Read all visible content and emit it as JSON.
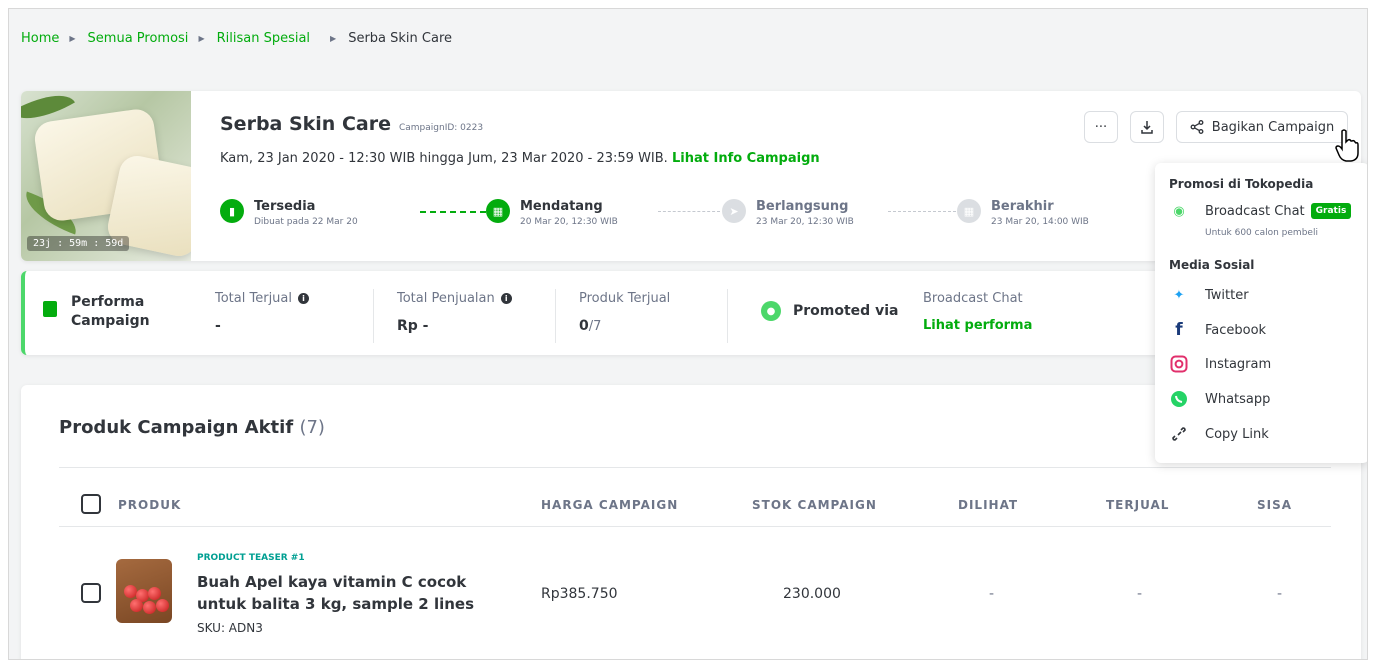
{
  "breadcrumb": [
    {
      "label": "Home"
    },
    {
      "label": "Semua Promosi"
    },
    {
      "label": "Rilisan Spesial"
    },
    {
      "label": "Serba Skin Care"
    }
  ],
  "campaign": {
    "title": "Serba Skin Care",
    "campaign_id": "CampaignID: 0223",
    "date_range": "Kam, 23 Jan 2020 - 12:30 WIB  hingga  Jum, 23 Mar 2020 - 23:59 WIB.",
    "info_link": "Lihat Info Campaign",
    "timer": "23j : 59m : 59d"
  },
  "steps": [
    {
      "name": "Tersedia",
      "sub": "Dibuat pada 22 Mar 20"
    },
    {
      "name": "Mendatang",
      "sub": "20 Mar 20, 12:30 WIB"
    },
    {
      "name": "Berlangsung",
      "sub": "23 Mar 20, 12:30 WIB"
    },
    {
      "name": "Berakhir",
      "sub": "23 Mar 20, 14:00 WIB"
    }
  ],
  "actions": {
    "more": "···",
    "share": "Bagikan Campaign"
  },
  "performance": {
    "title_line1": "Performa",
    "title_line2": "Campaign",
    "total_terjual_label": "Total Terjual",
    "total_terjual_value": "-",
    "total_penjualan_label": "Total Penjualan",
    "total_penjualan_value": "Rp -",
    "produk_terjual_label": "Produk Terjual",
    "produk_terjual_value": "0",
    "produk_terjual_total": "/7",
    "promoted_via": "Promoted via",
    "broadcast_label": "Broadcast Chat",
    "broadcast_link": "Lihat performa"
  },
  "product_list": {
    "title": "Produk Campaign Aktif",
    "count": "(7)",
    "columns": [
      "PRODUK",
      "HARGA CAMPAIGN",
      "STOK CAMPAIGN",
      "DILIHAT",
      "TERJUAL",
      "SISA"
    ],
    "rows": [
      {
        "teaser": "PRODUCT TEASER #1",
        "name": "Buah Apel kaya vitamin C cocok untuk balita 3 kg, sample 2 lines",
        "sku": "SKU: ADN3",
        "harga": "Rp385.750",
        "stok": "230.000",
        "dilihat": "-",
        "terjual": "-",
        "sisa": "-"
      }
    ]
  },
  "share_menu": {
    "section_promo": "Promosi di Tokopedia",
    "broadcast_chat": "Broadcast Chat",
    "gratis": "Gratis",
    "broadcast_sub": "Untuk 600 calon pembeli",
    "section_social": "Media Sosial",
    "items": [
      {
        "label": "Twitter",
        "icon": "twitter-icon",
        "color": "#1da1f2"
      },
      {
        "label": "Facebook",
        "icon": "facebook-icon",
        "color": "#1b3b7a"
      },
      {
        "label": "Instagram",
        "icon": "instagram-icon",
        "color": "#e1306c"
      },
      {
        "label": "Whatsapp",
        "icon": "whatsapp-icon",
        "color": "#25d366"
      },
      {
        "label": "Copy Link",
        "icon": "link-icon",
        "color": "#31353b"
      }
    ]
  },
  "colors": {
    "accent": "#03ac0e",
    "text": "#31353b",
    "muted": "#6d7588"
  }
}
